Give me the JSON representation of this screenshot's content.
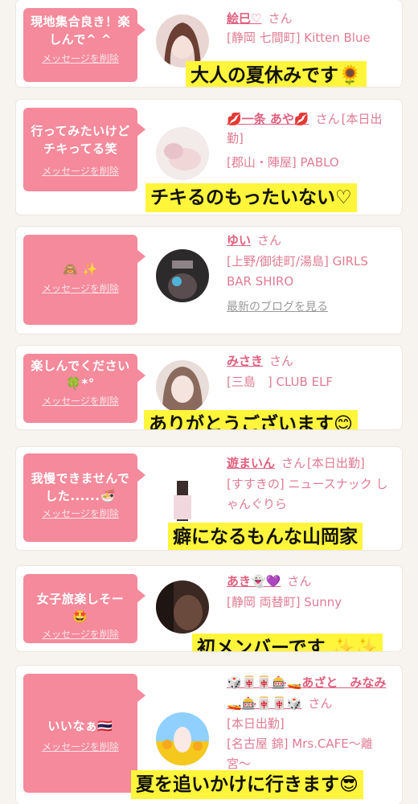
{
  "delete_label": "メッセージを削除",
  "blog_label": "最新のブログを見る",
  "san": "さん",
  "cards": [
    {
      "message": "現地集合良き！楽しんで^ ^",
      "name": "絵巳♡",
      "shop": "[静岡 七間町] Kitten Blue",
      "caption": "大人の夏休みです🌻"
    },
    {
      "message": "行ってみたいけどチキってる笑",
      "name": "💋一条 あや💋",
      "status": "[本日出勤]",
      "shop": "[郡山・陣屋] PABLO",
      "caption": "チキるのもったいない♡"
    },
    {
      "message": "🙈 ✨",
      "name": "ゆい",
      "shop": "[上野/御徒町/湯島] GIRLS BAR SHIRO",
      "blog": "最新のブログを見る"
    },
    {
      "message": "楽しんでください🍀*°",
      "name": "みさき",
      "shop": "[三島　] CLUB ELF",
      "caption": "ありがとうございます😊"
    },
    {
      "message": "我慢できませんでした......🍜",
      "name": "遊まいん",
      "status": "[本日出勤]",
      "shop": "[すすきの] ニュースナック しゃんぐりら",
      "caption": "癖になるもんな山岡家"
    },
    {
      "message": "女子旅楽しそー🤩",
      "name": "あき👻💜",
      "shop": "[静岡 両替町] Sunny",
      "caption": "初メンバーです ✨✨"
    },
    {
      "message": "いいなぁ🇹🇭",
      "name": "🎲🀄🀄🎰🚤あざと　みなみ🚤🎰🀄🀄🎲",
      "status": "[本日出勤]",
      "shop": "[名古屋 錦] Mrs.CAFE〜離宮〜",
      "caption": "夏を追いかけに行きます😎"
    }
  ],
  "colors": {
    "bubble": "#f48a9c",
    "name": "#e0607e",
    "caption_bg": "#fff53a"
  }
}
